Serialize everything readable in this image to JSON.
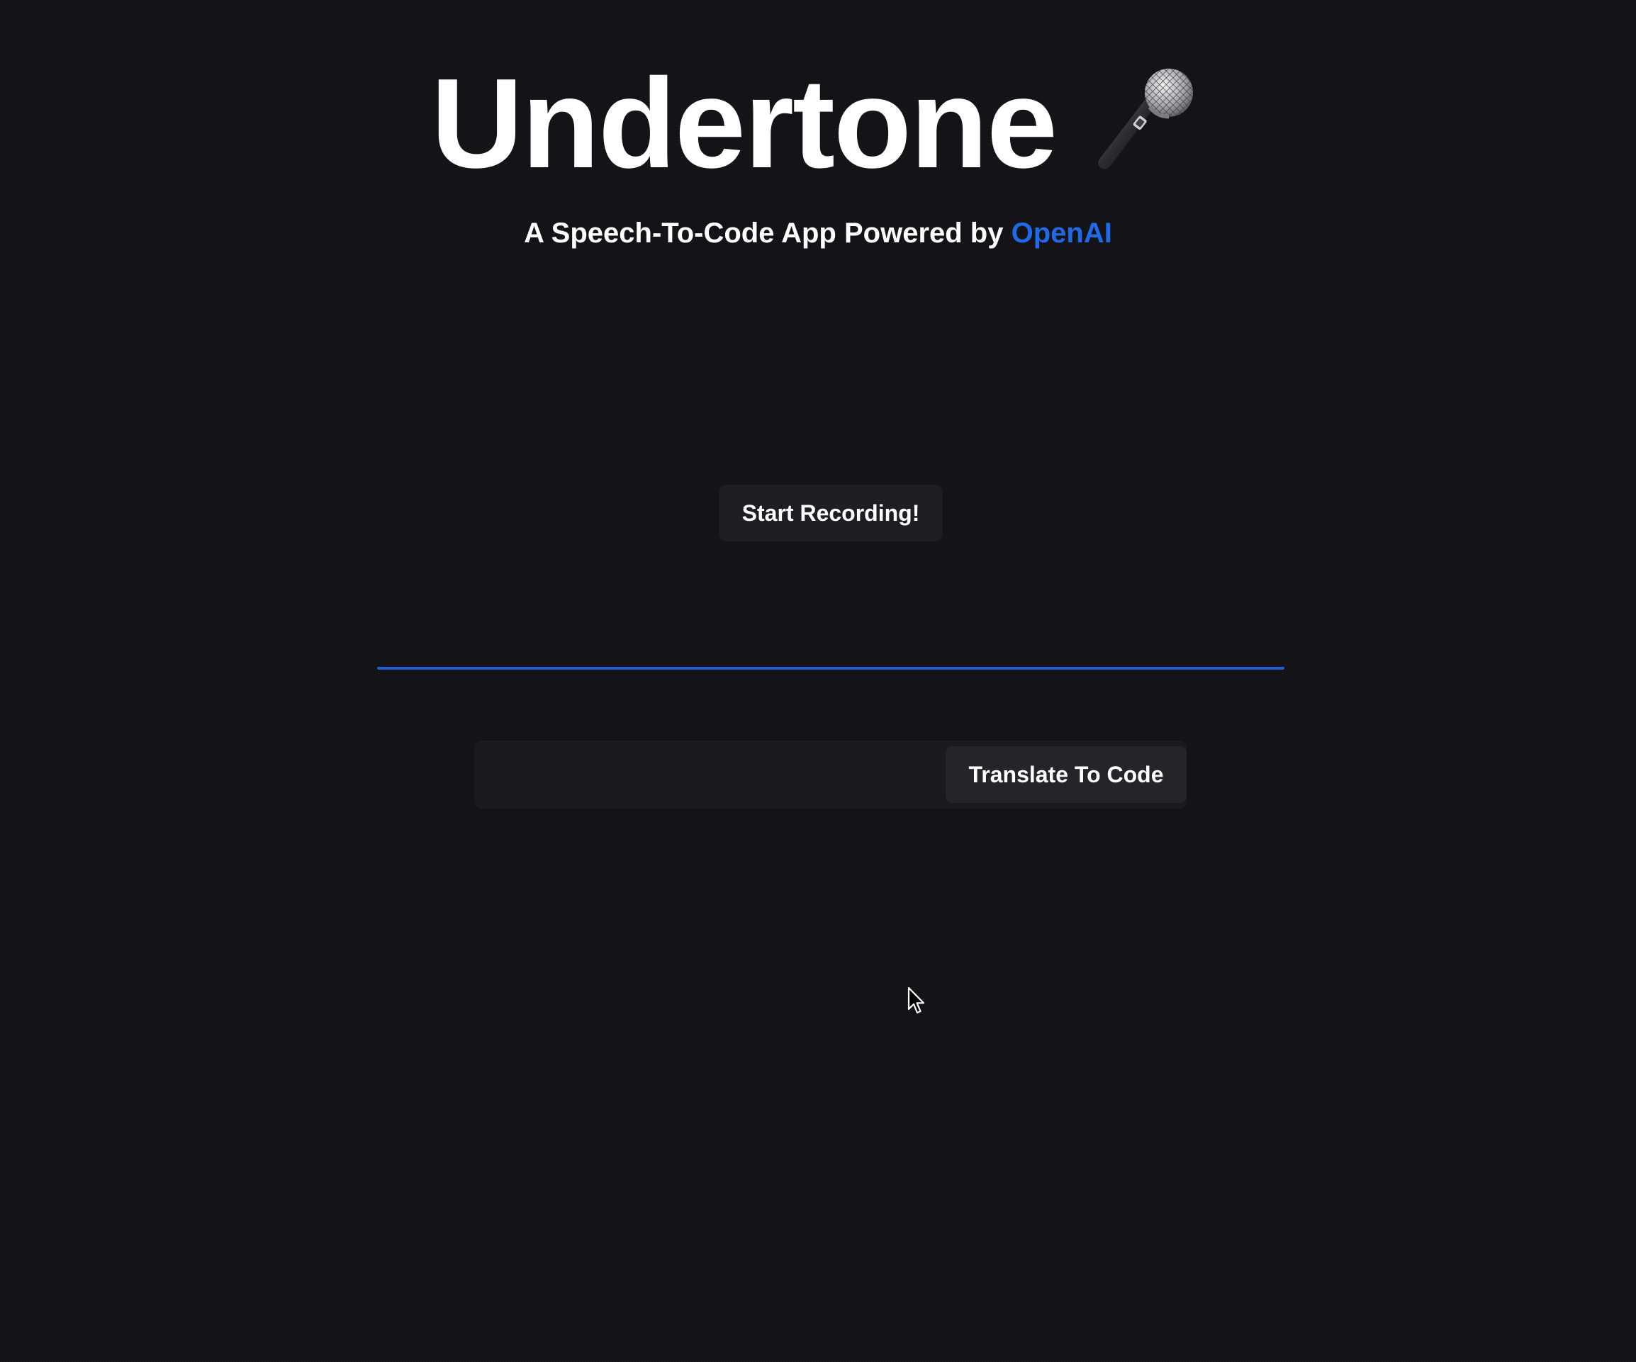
{
  "header": {
    "title": "Undertone",
    "subtitle_prefix": "A Speech-To-Code App Powered by",
    "subtitle_brand": "OpenAI"
  },
  "icons": {
    "title_icon": "microphone-icon",
    "pointer": "mouse-cursor-icon"
  },
  "recording": {
    "button_label": "Start Recording!"
  },
  "translate": {
    "input_value": "",
    "input_placeholder": "",
    "button_label": "Translate To Code"
  },
  "colors": {
    "background": "#121217",
    "brand_blue": "#1f6ae6",
    "divider_blue": "#1f5fcf",
    "button_bg": "#1f1e25",
    "text": "#ffffff"
  }
}
